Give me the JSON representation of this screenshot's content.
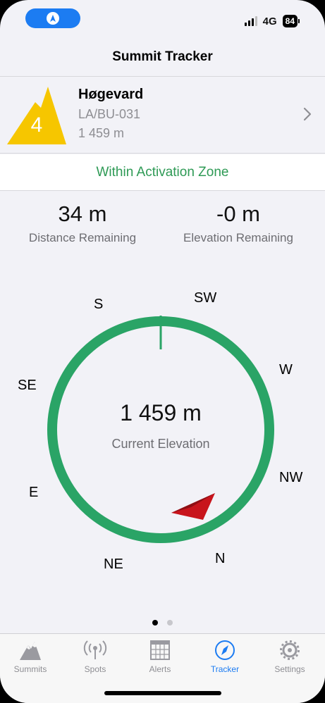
{
  "status_bar": {
    "network": "4G",
    "battery": "84",
    "pill_icon": "navigation-arrow-icon"
  },
  "nav": {
    "title": "Summit Tracker"
  },
  "summit": {
    "points": "4",
    "name": "Høgevard",
    "reference": "LA/BU-031",
    "altitude": "1 459 m",
    "icon": "mountain-icon",
    "icon_color": "#f6c600"
  },
  "zone": {
    "text": "Within Activation Zone",
    "color": "#2e9a55"
  },
  "stats": {
    "distance": {
      "value": "34 m",
      "label": "Distance Remaining"
    },
    "elevation": {
      "value": "-0 m",
      "label": "Elevation Remaining"
    }
  },
  "compass": {
    "directions": {
      "s": "S",
      "sw": "SW",
      "w": "W",
      "nw": "NW",
      "n": "N",
      "ne": "NE",
      "e": "E",
      "se": "SE"
    },
    "ring_color": "#2aa466",
    "pointer_color": "#c8141c",
    "current_elevation": "1 459 m",
    "current_elevation_label": "Current Elevation"
  },
  "pager": {
    "total": 2,
    "active": 0
  },
  "tabs": [
    {
      "label": "Summits",
      "icon": "mountain-icon"
    },
    {
      "label": "Spots",
      "icon": "antenna-icon"
    },
    {
      "label": "Alerts",
      "icon": "calendar-icon"
    },
    {
      "label": "Tracker",
      "icon": "compass-icon",
      "active": true
    },
    {
      "label": "Settings",
      "icon": "gear-icon"
    }
  ],
  "accent_color": "#1c7cf2"
}
